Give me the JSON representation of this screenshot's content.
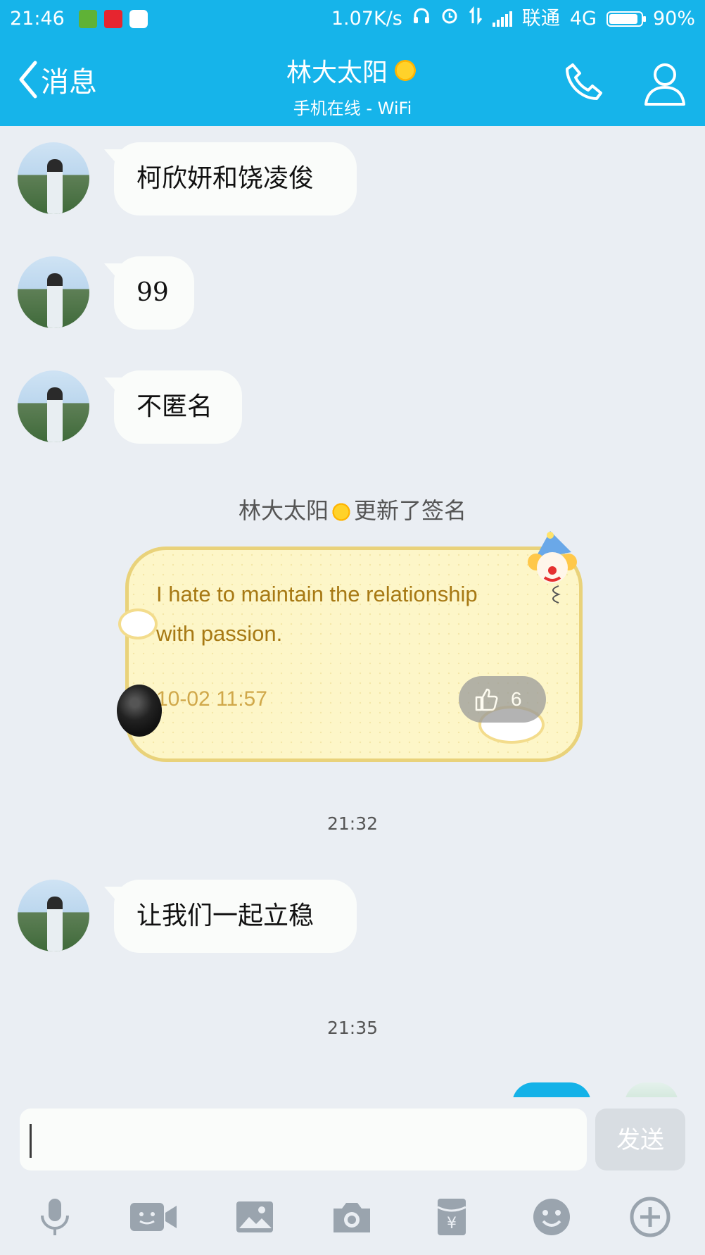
{
  "status_bar": {
    "time": "21:46",
    "speed": "1.07K/s",
    "carrier": "联通",
    "network": "4G",
    "battery": "90%",
    "battery_level": 0.9
  },
  "navbar": {
    "back_label": "消息",
    "contact_name": "林大太阳",
    "status": "手机在线 - WiFi"
  },
  "messages": [
    {
      "text": "柯欣妍和饶凌俊"
    },
    {
      "text": "99"
    },
    {
      "text": "不匿名"
    }
  ],
  "signature_update": {
    "name": "林大太阳",
    "action": "更新了签名",
    "text": "I hate to maintain the relationship with passion.",
    "date": "10-02 11:57",
    "likes": "6"
  },
  "timestamps": [
    "21:32",
    "21:35"
  ],
  "message_after": {
    "text": "让我们一起立稳"
  },
  "input": {
    "placeholder": "",
    "send_label": "发送"
  },
  "colors": {
    "header": "#16b4ea",
    "background": "#eaeef3",
    "bubble": "#fafcfa"
  }
}
